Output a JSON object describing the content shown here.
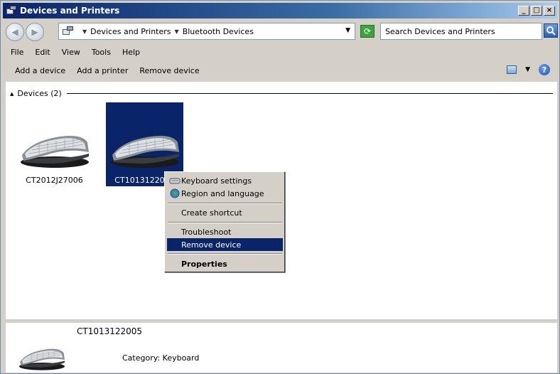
{
  "window": {
    "title": "Devices and Printers",
    "controls": {
      "minimize": "_",
      "maximize": "□",
      "close": "×"
    }
  },
  "address": {
    "crumbs": [
      "Devices and Printers",
      "Bluetooth Devices"
    ],
    "search_placeholder": "Search Devices and Printers"
  },
  "menu": [
    "File",
    "Edit",
    "View",
    "Tools",
    "Help"
  ],
  "commands": [
    "Add a device",
    "Add a printer",
    "Remove device"
  ],
  "group": {
    "label": "Devices (2)"
  },
  "devices": [
    {
      "label": "CT2012J27006",
      "selected": false
    },
    {
      "label": "CT1013122005",
      "selected": true
    }
  ],
  "context_menu": {
    "items": [
      {
        "label": "Keyboard settings",
        "icon": "keyboard-icon"
      },
      {
        "label": "Region and language",
        "icon": "globe-icon"
      },
      {
        "label": "Create shortcut"
      },
      {
        "label": "Troubleshoot"
      },
      {
        "label": "Remove device",
        "highlighted": true
      },
      {
        "label": "Properties",
        "bold": true
      }
    ]
  },
  "details": {
    "name": "CT1013122005",
    "category": "Category: Keyboard"
  },
  "colors": {
    "selection": "#0a246a",
    "titlebar": "#0a246a",
    "face": "#d4d0c8"
  }
}
